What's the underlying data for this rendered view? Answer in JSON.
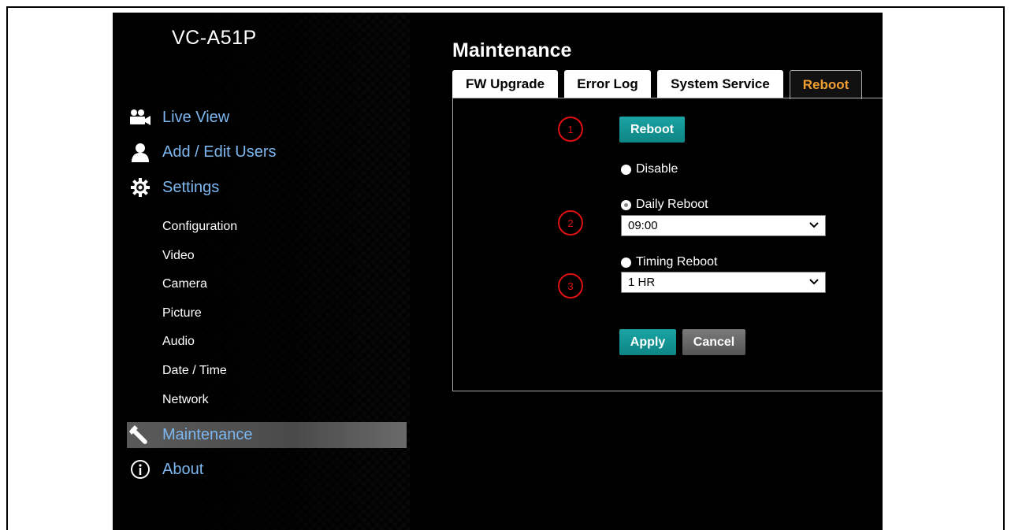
{
  "device_name": "VC-A51P",
  "nav": {
    "main": [
      {
        "label": "Live View",
        "icon": "video-camera-icon"
      },
      {
        "label": "Add / Edit Users",
        "icon": "user-icon"
      },
      {
        "label": "Settings",
        "icon": "gear-icon"
      }
    ],
    "settings_sub": [
      "Configuration",
      "Video",
      "Camera",
      "Picture",
      "Audio",
      "Date / Time",
      "Network"
    ],
    "maintenance": {
      "label": "Maintenance",
      "icon": "wrench-icon",
      "active": true
    },
    "about": {
      "label": "About",
      "icon": "info-icon"
    }
  },
  "page_title": "Maintenance",
  "tabs": [
    {
      "label": "FW Upgrade",
      "active": false
    },
    {
      "label": "Error Log",
      "active": false
    },
    {
      "label": "System Service",
      "active": false
    },
    {
      "label": "Reboot",
      "active": true
    }
  ],
  "reboot": {
    "reboot_button": "Reboot",
    "options": {
      "disable": "Disable",
      "daily": "Daily Reboot",
      "timing": "Timing Reboot"
    },
    "selected_option": "daily",
    "daily_time": "09:00",
    "timing_interval": "1 HR",
    "apply_button": "Apply",
    "cancel_button": "Cancel"
  },
  "markers": [
    "1",
    "2",
    "3"
  ],
  "colors": {
    "nav_link": "#7db7f0",
    "active_tab": "#f0a030",
    "button_primary": "#0e8585",
    "marker": "#e01010"
  }
}
